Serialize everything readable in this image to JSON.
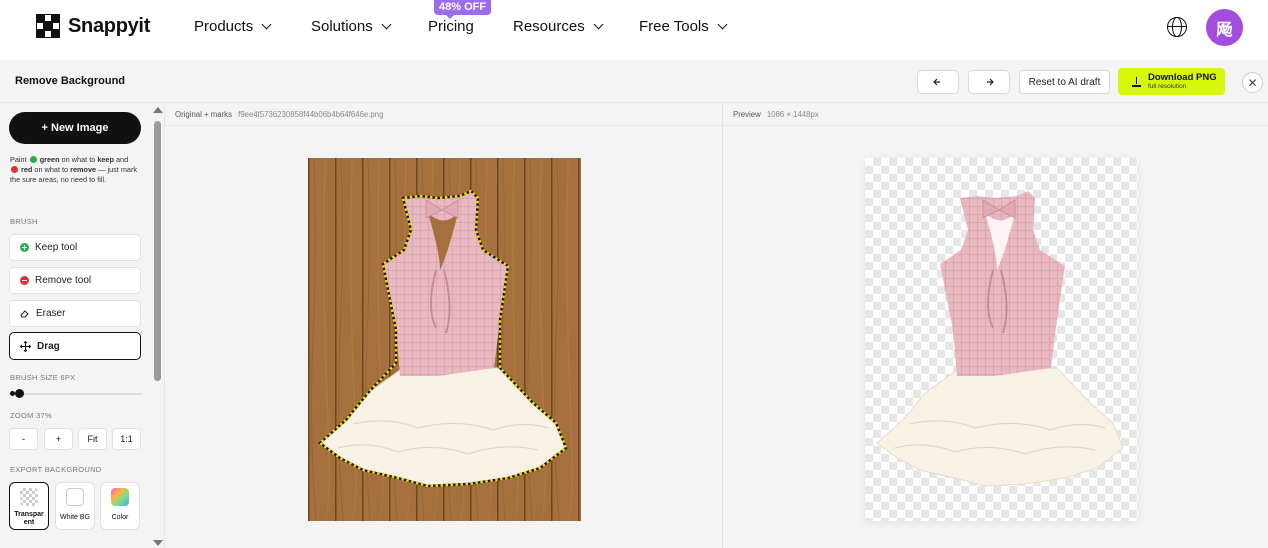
{
  "brand": {
    "name": "Snappyit"
  },
  "nav": {
    "items": [
      "Products",
      "Solutions",
      "Pricing",
      "Resources",
      "Free Tools"
    ],
    "promo_badge": "48% OFF",
    "avatar_initial": "飏"
  },
  "toolbar": {
    "title": "Remove Background",
    "reset_label": "Reset to AI draft",
    "download_label": "Download PNG",
    "download_sub": "full resolution"
  },
  "sidebar": {
    "new_image_label": "+ New Image",
    "hint": {
      "p1": "Paint ",
      "green": "green",
      "p2": " on what to ",
      "keep": "keep",
      "p3": " and ",
      "red": "red",
      "p4": " on what to ",
      "remove": "remove",
      "p5": " — just mark the sure areas, no need to fill."
    },
    "brush_label": "BRUSH",
    "tools": [
      "Keep tool",
      "Remove tool",
      "Eraser",
      "Drag"
    ],
    "active_tool": "Drag",
    "brush_size_label": "BRUSH SIZE 6PX",
    "zoom_label": "ZOOM 37%",
    "zoom_buttons": [
      "-",
      "+",
      "Fit",
      "1:1"
    ],
    "export_bg_label": "EXPORT BACKGROUND",
    "export_options": [
      "Transparent",
      "White BG",
      "Color"
    ],
    "export_display": [
      "Transpar\nent",
      "White BG",
      "Color"
    ],
    "active_export": "Transparent"
  },
  "original_panel": {
    "title": "Original + marks",
    "filename": "f9ee4f5736230858f44b06b4b64f646e.png"
  },
  "preview_panel": {
    "title": "Preview",
    "dimensions": "1086 × 1448px"
  },
  "colors": {
    "accent": "#d7f708",
    "promo": "#9b6cf0",
    "avatar": "#a34ce0",
    "keep_green": "#22b14c",
    "remove_red": "#e03131",
    "wood": "#a5703d",
    "dress_pink": "#e9b9c2"
  }
}
